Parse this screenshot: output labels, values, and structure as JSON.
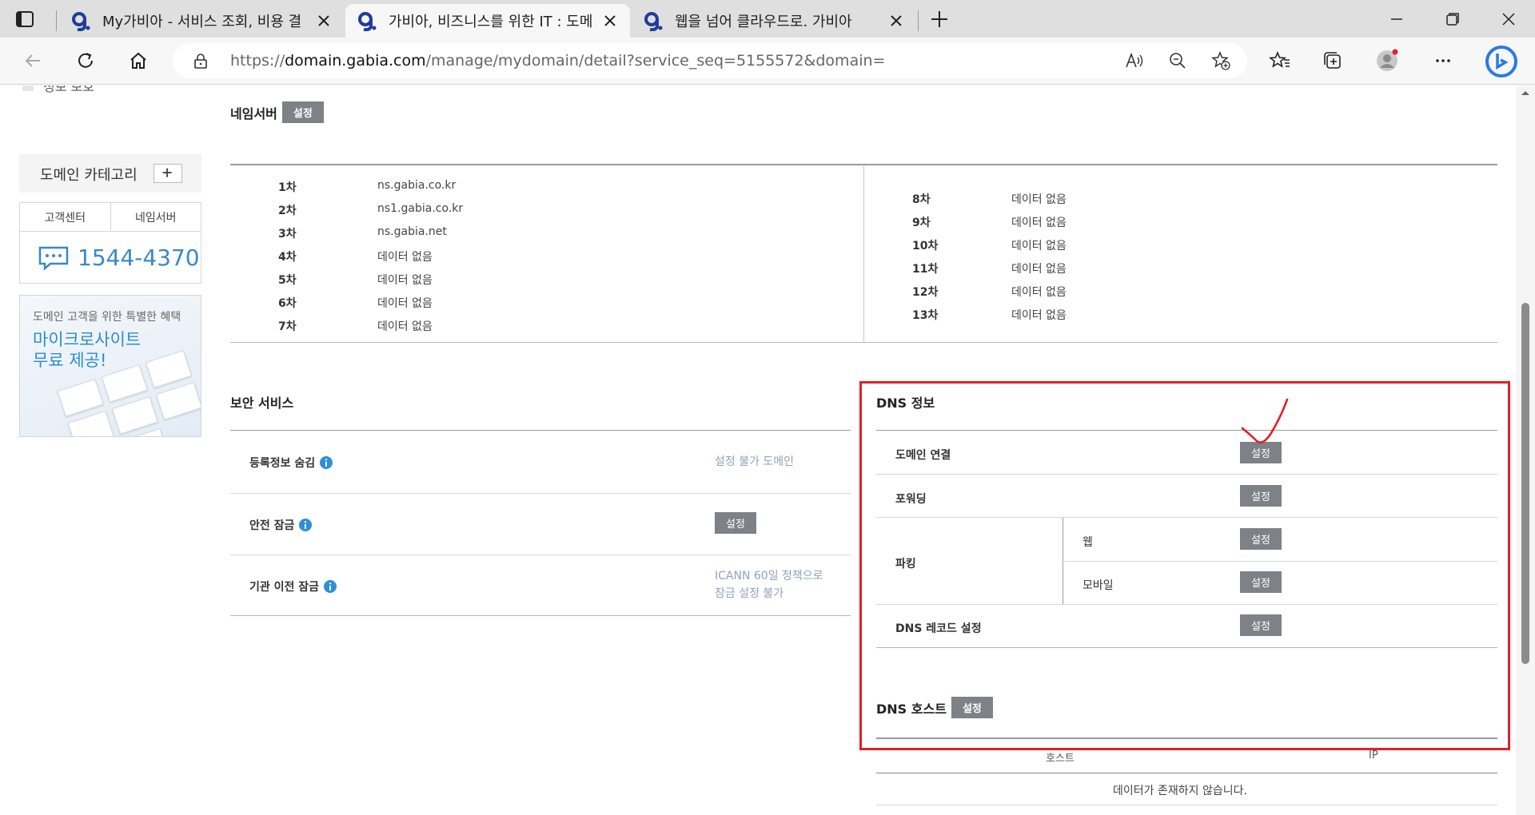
{
  "browser": {
    "tabs": [
      {
        "title": "My가비아 - 서비스 조회, 비용 결",
        "active": false
      },
      {
        "title": "가비아, 비즈니스를 위한 IT : 도메",
        "active": true
      },
      {
        "title": "웹을 넘어 클라우드로. 가비아",
        "active": false
      }
    ],
    "url_scheme": "https://",
    "url_host": "domain.gabia.com",
    "url_path": "/manage/mydomain/detail?service_seq=5155572&domain=l"
  },
  "sidebar": {
    "top_item": "정보 보호",
    "category_label": "도메인 카테고리",
    "support_tabs": [
      "고객센터",
      "네임서버"
    ],
    "phone": "1544-4370",
    "banner_line1": "도메인 고객을 위한 특별한 혜택",
    "banner_line2": "마이크로사이트 무료 제공!"
  },
  "nameserver": {
    "title": "네임서버",
    "button": "설정",
    "left": [
      {
        "k": "1차",
        "v": "ns.gabia.co.kr"
      },
      {
        "k": "2차",
        "v": "ns1.gabia.co.kr"
      },
      {
        "k": "3차",
        "v": "ns.gabia.net"
      },
      {
        "k": "4차",
        "v": "데이터 없음"
      },
      {
        "k": "5차",
        "v": "데이터 없음"
      },
      {
        "k": "6차",
        "v": "데이터 없음"
      },
      {
        "k": "7차",
        "v": "데이터 없음"
      }
    ],
    "right": [
      {
        "k": "8차",
        "v": "데이터 없음"
      },
      {
        "k": "9차",
        "v": "데이터 없음"
      },
      {
        "k": "10차",
        "v": "데이터 없음"
      },
      {
        "k": "11차",
        "v": "데이터 없음"
      },
      {
        "k": "12차",
        "v": "데이터 없음"
      },
      {
        "k": "13차",
        "v": "데이터 없음"
      }
    ]
  },
  "security": {
    "title": "보안 서비스",
    "rows": [
      {
        "label": "등록정보 숨김",
        "value": "설정 불가 도메인"
      },
      {
        "label": "안전 잠금",
        "button": "설정"
      },
      {
        "label": "기관 이전 잠금",
        "value_line1": "ICANN 60일 정책으로",
        "value_line2": "잠금 설정 불가"
      }
    ]
  },
  "dns": {
    "title": "DNS 정보",
    "rows": {
      "domain_connect": "도메인 연결",
      "forwarding": "포워딩",
      "parking": "파킹",
      "parking_web": "웹",
      "parking_mobile": "모바일",
      "dns_record": "DNS 레코드 설정"
    },
    "button": "설정"
  },
  "dns_host": {
    "title": "DNS 호스트",
    "button": "설정",
    "col_host": "호스트",
    "col_ip": "IP",
    "empty": "데이터가 존재하지 않습니다."
  },
  "colors": {
    "highlight": "#e0202a",
    "button": "#7e8187",
    "accent": "#3a88c8"
  }
}
